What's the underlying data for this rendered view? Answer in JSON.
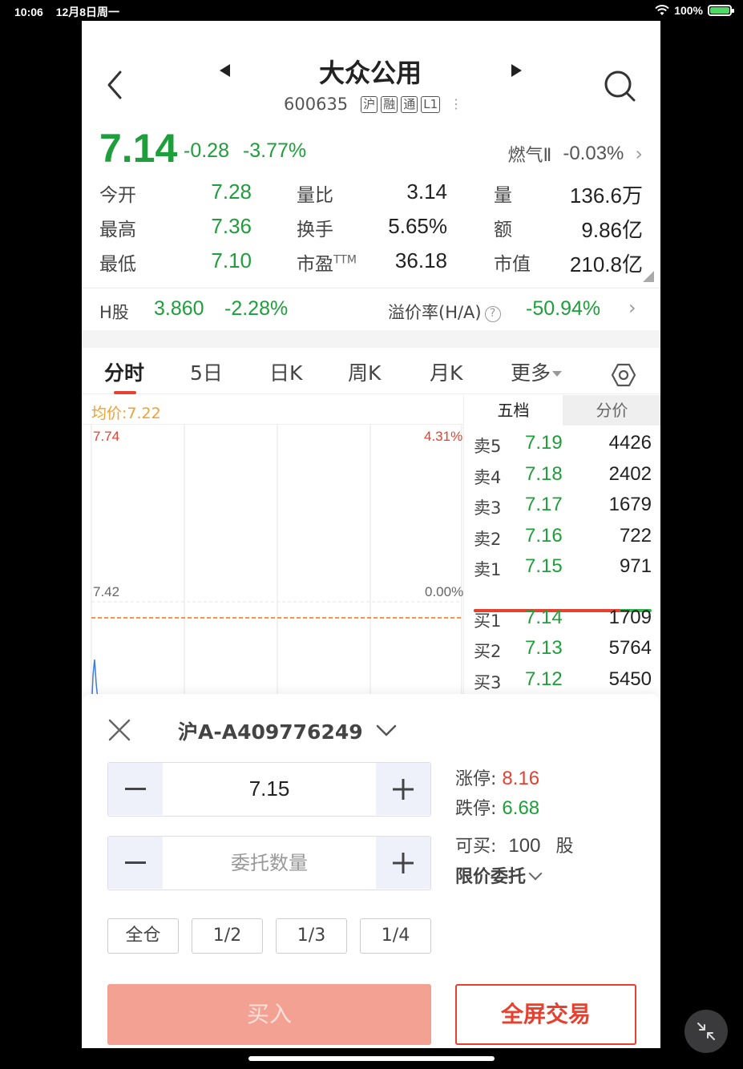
{
  "status_bar": {
    "time": "10:06",
    "date": "12月8日周一",
    "battery": "100%"
  },
  "header": {
    "title": "大众公用",
    "code": "600635",
    "tags": [
      "沪",
      "融",
      "通",
      "L1"
    ]
  },
  "quote": {
    "price": "7.14",
    "change": "-0.28",
    "change_pct": "-3.77%",
    "sector_name": "燃气Ⅱ",
    "sector_change": "-0.03%"
  },
  "stats": {
    "open_label": "今开",
    "open": "7.28",
    "vol_ratio_label": "量比",
    "vol_ratio": "3.14",
    "volume_label": "量",
    "volume": "136.6万",
    "high_label": "最高",
    "high": "7.36",
    "turnover_label": "换手",
    "turnover": "5.65%",
    "amount_label": "额",
    "amount": "9.86亿",
    "low_label": "最低",
    "low": "7.10",
    "pe_label": "市盈",
    "pe_sup": "TTM",
    "pe": "36.18",
    "mktcap_label": "市值",
    "mktcap": "210.8亿"
  },
  "h_share": {
    "label": "H股",
    "price": "3.860",
    "change_pct": "-2.28%",
    "premium_label": "溢价率(H/A)",
    "premium": "-50.94%"
  },
  "tabs": [
    "分时",
    "5日",
    "日K",
    "周K",
    "月K",
    "更多"
  ],
  "chart": {
    "avg_label": "均价:7.22",
    "top_price": "7.74",
    "top_pct": "4.31%",
    "mid_price": "7.42",
    "mid_pct": "0.00%"
  },
  "order_book": {
    "tab_depth": "五档",
    "tab_price": "分价",
    "asks": [
      {
        "label": "卖5",
        "price": "7.19",
        "vol": "4426"
      },
      {
        "label": "卖4",
        "price": "7.18",
        "vol": "2402"
      },
      {
        "label": "卖3",
        "price": "7.17",
        "vol": "1679"
      },
      {
        "label": "卖2",
        "price": "7.16",
        "vol": "722"
      },
      {
        "label": "卖1",
        "price": "7.15",
        "vol": "971"
      }
    ],
    "bids": [
      {
        "label": "买1",
        "price": "7.14",
        "vol": "1709"
      },
      {
        "label": "买2",
        "price": "7.13",
        "vol": "5764"
      },
      {
        "label": "买3",
        "price": "7.12",
        "vol": "5450"
      }
    ],
    "sell_ratio": 0.82,
    "colors": {
      "sell": "#e8402f",
      "buy": "#2fb34a"
    }
  },
  "trade": {
    "account": "沪A-A409776249",
    "price_value": "7.15",
    "qty_placeholder": "委托数量",
    "limit_up_label": "涨停:",
    "limit_up": "8.16",
    "limit_down_label": "跌停:",
    "limit_down": "6.68",
    "can_buy_label": "可买:",
    "can_buy": "100",
    "can_buy_unit": "股",
    "order_type": "限价委托",
    "positions": [
      "全仓",
      "1/2",
      "1/3",
      "1/4"
    ],
    "buy_label": "买入",
    "fullscreen_label": "全屏交易"
  },
  "colors": {
    "up": "#e8402f",
    "down": "#1f9e3c",
    "avg_line": "#f0a030",
    "price_line": "#3b7ddd"
  }
}
